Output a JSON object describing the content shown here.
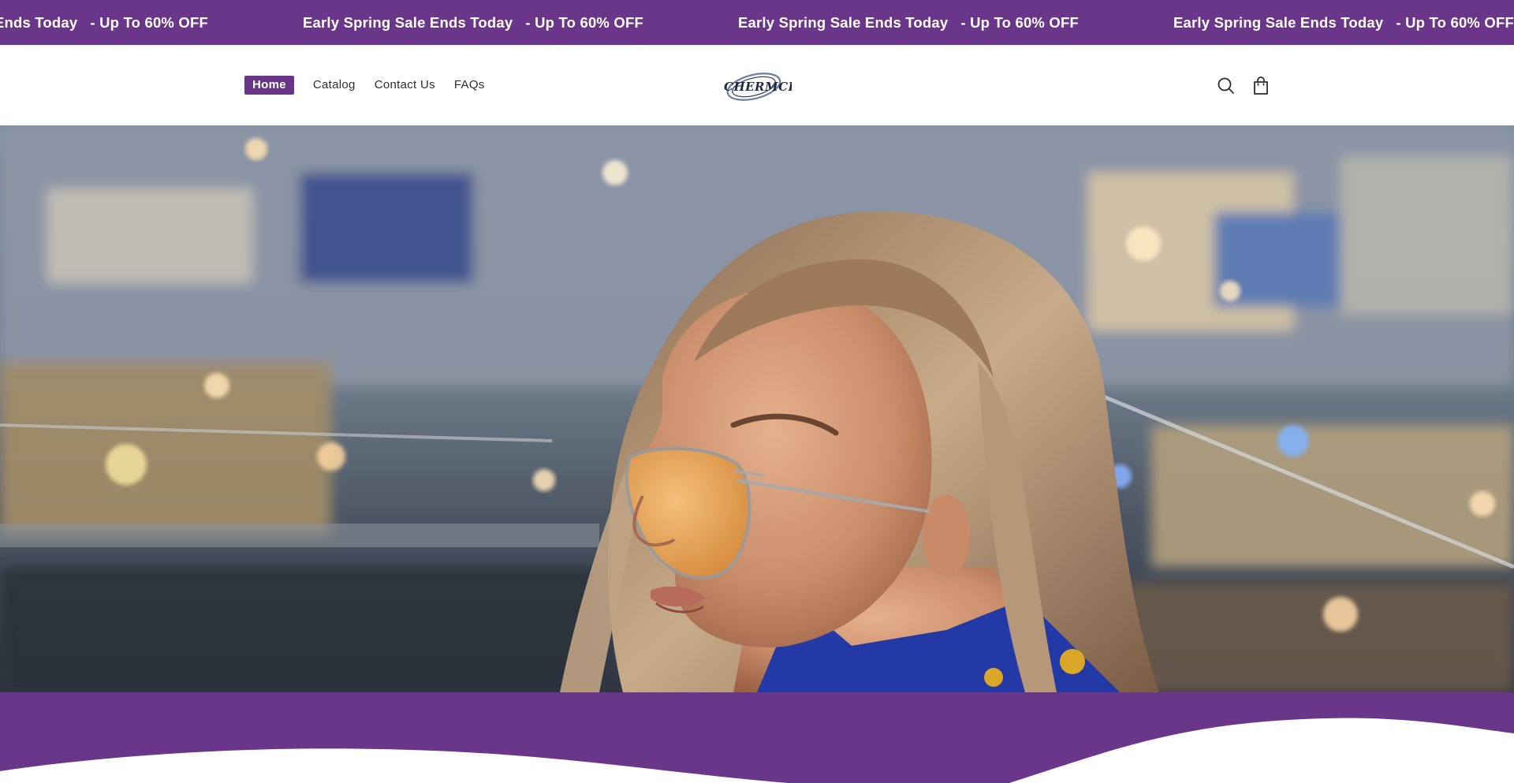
{
  "announcement": {
    "items": [
      {
        "left": "Early Spring Sale Ends Today",
        "right": "- Up To 60% OFF"
      },
      {
        "left": "Early Spring Sale Ends Today",
        "right": "- Up To 60% OFF"
      },
      {
        "left": "Early Spring Sale Ends Today",
        "right": "- Up To 60% OFF"
      },
      {
        "left": "Early Spring Sale Ends Today",
        "right": "- Up To 60% OFF"
      }
    ],
    "background": "#6a3689"
  },
  "header": {
    "nav": [
      {
        "label": "Home",
        "active": true
      },
      {
        "label": "Catalog",
        "active": false
      },
      {
        "label": "Contact Us",
        "active": false
      },
      {
        "label": "FAQs",
        "active": false
      }
    ],
    "logo_text": "CHERMCH",
    "icons": [
      "search-icon",
      "cart-icon"
    ]
  },
  "hero": {
    "image": "woman-with-aviator-sunglasses"
  },
  "colors": {
    "brand": "#6a3689",
    "text": "#2d2d2d",
    "white": "#ffffff"
  }
}
